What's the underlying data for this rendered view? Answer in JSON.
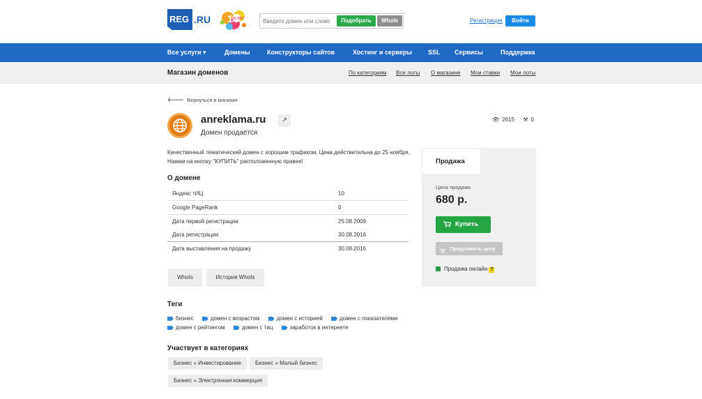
{
  "header": {
    "logo_text": "REG",
    "logo_suffix": ".RU",
    "anniversary": "10 ЛЕТ",
    "search_placeholder": "Введите домен или слово",
    "pick_label": "Подобрать",
    "whois_label": "WhoIs",
    "register_label": "Регистрация",
    "login_label": "Войти"
  },
  "nav": {
    "items": [
      "Все услуги ▾",
      "Домены",
      "Конструкторы сайтов",
      "Хостинг и серверы",
      "SSL",
      "Сервисы",
      "Поддержка"
    ]
  },
  "subnav": {
    "title": "Магазин доменов",
    "links": [
      "По категориям",
      "Все лоты",
      "О магазине",
      "Мои ставки",
      "Мои лоты"
    ]
  },
  "back_label": "Вернуться в магазин",
  "domain": {
    "name": "anreklama.ru",
    "status": "Домен продаётся",
    "views": "2615",
    "bids": "0",
    "description_1": "Качественный тематический домен с хорошим трафиком. Цена действительна до 25 ноября.",
    "description_2": "Нажми на кнопку \"КУПИТЬ\" расположенную правее!"
  },
  "about": {
    "title": "О домене",
    "rows": [
      {
        "label": "Яндекс тИЦ",
        "value": "10"
      },
      {
        "label": "Google PageRank",
        "value": "0"
      },
      {
        "label": "Дата первой регистрации",
        "value": "25.08.2009"
      },
      {
        "label": "Дата регистрации",
        "value": "30.08.2016"
      },
      {
        "label": "Дата выставления на продажу",
        "value": "30.08.2016"
      }
    ],
    "whois_button": "WhoIs",
    "history_button": "История WhoIs"
  },
  "tags": {
    "title": "Теги",
    "items": [
      "бизнес",
      "домен с возрастом",
      "домен с историей",
      "домен с показателями",
      "домен с рейтингом",
      "домен с тиц",
      "заработок в интернете"
    ]
  },
  "categories": {
    "title": "Участвует в категориях",
    "items": [
      "Бизнес » Инвестирование",
      "Бизнес » Малый бизнес",
      "Бизнес » Электронная коммерция"
    ]
  },
  "sale": {
    "tab_label": "Продажа",
    "price_label": "Цена продажи",
    "price": "680 р.",
    "buy_label": "Купить",
    "offer_label": "Предложить цену",
    "online_label": "Продажа онлайн",
    "help_mark": "?"
  },
  "colors": {
    "brand_blue": "#1f6ac4",
    "buy_green": "#26a544",
    "login_blue": "#1c8be5"
  }
}
